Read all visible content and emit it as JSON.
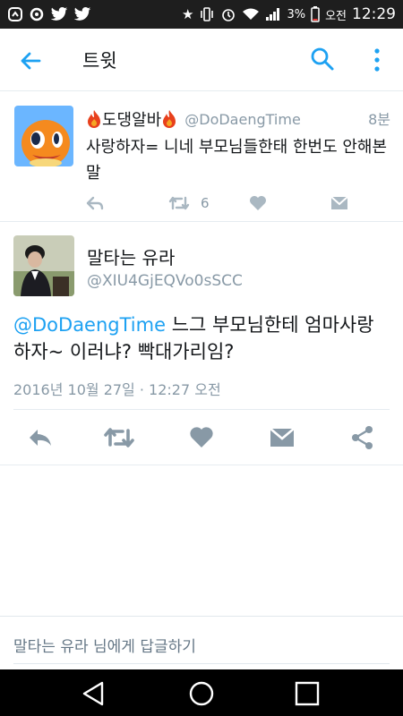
{
  "status_bar": {
    "battery_percent": "3%",
    "ampm": "오전",
    "clock": "12:29"
  },
  "app_bar": {
    "title": "트윗"
  },
  "tweets": [
    {
      "display_name": "도댕알바",
      "handle": "@DoDaengTime",
      "time": "8분",
      "text": "사랑하자= 니네 부모님들한태 한번도 안해본말",
      "retweet_count": "6"
    },
    {
      "display_name": "말타는 유라",
      "handle": "@XIU4GjEQVo0sSCC",
      "mention": "@DoDaengTime",
      "text": " 느그 부모님한테 엄마사랑하자~ 이러냐? 빡대가리임?",
      "date": "2016년 10월 27일 · 12:27 오전"
    }
  ],
  "reply_bar": {
    "placeholder": "말타는 유라 님에게 답글하기"
  },
  "colors": {
    "accent": "#1da1f2",
    "icon_gray": "#8899a6",
    "text": "#14171a"
  }
}
